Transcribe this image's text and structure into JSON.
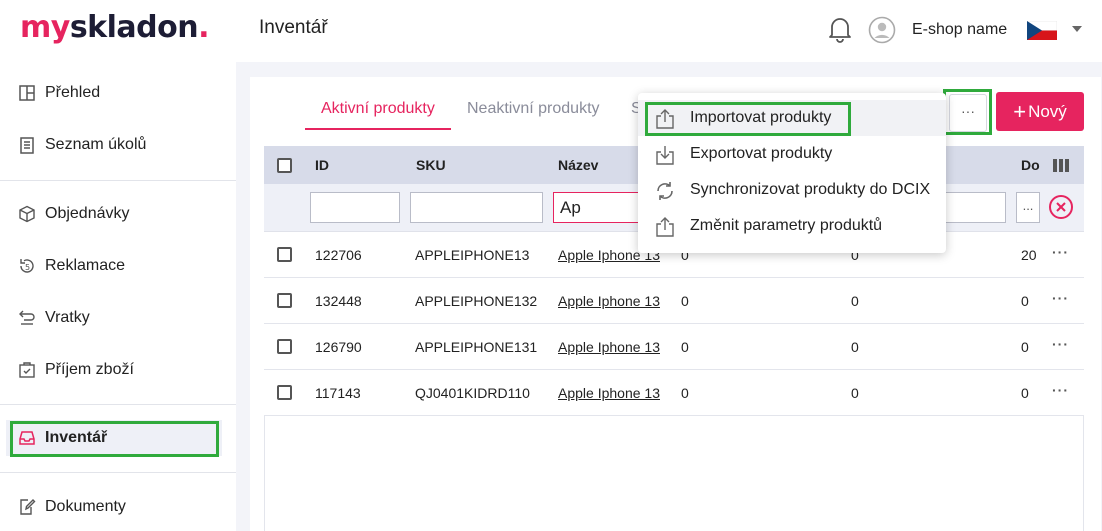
{
  "brand": {
    "my": "my",
    "skladon": "skladon",
    "dot": ".",
    "accent": "#e6245f"
  },
  "header": {
    "title": "Inventář",
    "shop_name": "E-shop name",
    "flag": "cz-flag-icon"
  },
  "sidebar": {
    "items": [
      {
        "label": "Přehled",
        "icon": "overview-icon"
      },
      {
        "label": "Seznam úkolů",
        "icon": "task-list-icon"
      },
      {
        "label": "Objednávky",
        "icon": "box-icon"
      },
      {
        "label": "Reklamace",
        "icon": "complaint-icon"
      },
      {
        "label": "Vratky",
        "icon": "return-icon"
      },
      {
        "label": "Příjem zboží",
        "icon": "receiving-icon"
      },
      {
        "label": "Inventář",
        "icon": "inbox-icon"
      },
      {
        "label": "Dokumenty",
        "icon": "document-edit-icon"
      }
    ]
  },
  "tabs": {
    "active": "Aktivní produkty",
    "inactive": "Neaktivní produkty",
    "partial": "S"
  },
  "toolbar": {
    "more_label": "···",
    "new_label": "Nový",
    "new_plus": "+"
  },
  "table": {
    "headers": {
      "id": "ID",
      "sku": "SKU",
      "name": "Název",
      "do": "Do"
    },
    "filters": {
      "id": "",
      "sku": "",
      "name": "Ap",
      "other": "",
      "more": "..."
    },
    "rows": [
      {
        "id": "122706",
        "sku": "APPLEIPHONE13",
        "name": "Apple Iphone 13",
        "c1": "0",
        "c2": "0",
        "c3": "20"
      },
      {
        "id": "132448",
        "sku": "APPLEIPHONE132",
        "name": "Apple Iphone 13",
        "c1": "0",
        "c2": "0",
        "c3": "0"
      },
      {
        "id": "126790",
        "sku": "APPLEIPHONE131",
        "name": "Apple Iphone 13",
        "c1": "0",
        "c2": "0",
        "c3": "0"
      },
      {
        "id": "117143",
        "sku": "QJ0401KIDRD110",
        "name": "Apple Iphone 13",
        "c1": "0",
        "c2": "0",
        "c3": "0"
      }
    ],
    "row_menu": "···"
  },
  "dropdown": {
    "items": [
      {
        "label": "Importovat produkty",
        "icon": "upload-icon"
      },
      {
        "label": "Exportovat produkty",
        "icon": "download-icon"
      },
      {
        "label": "Synchronizovat produkty do DCIX",
        "icon": "sync-icon"
      },
      {
        "label": "Změnit parametry produktů",
        "icon": "upload-icon"
      }
    ]
  },
  "colors": {
    "accent": "#e6245f",
    "highlight": "#2faa3c",
    "header_row": "#d7dbe9"
  }
}
